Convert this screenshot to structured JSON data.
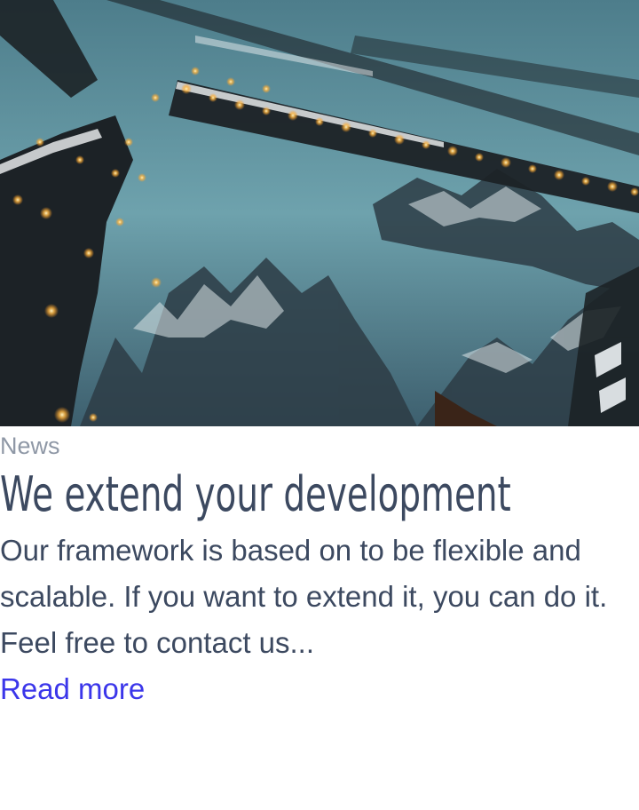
{
  "card": {
    "image_alt": "Snowy trees with string lights at dusk",
    "category": "News",
    "title": "We extend your development",
    "excerpt": "Our framework is based on to be flexible and scalable. If you want to extend it, you can do it. Feel free to contact us...",
    "read_more": "Read more"
  },
  "colors": {
    "category": "#8f98a6",
    "text": "#3c4960",
    "link": "#3b36ea"
  }
}
